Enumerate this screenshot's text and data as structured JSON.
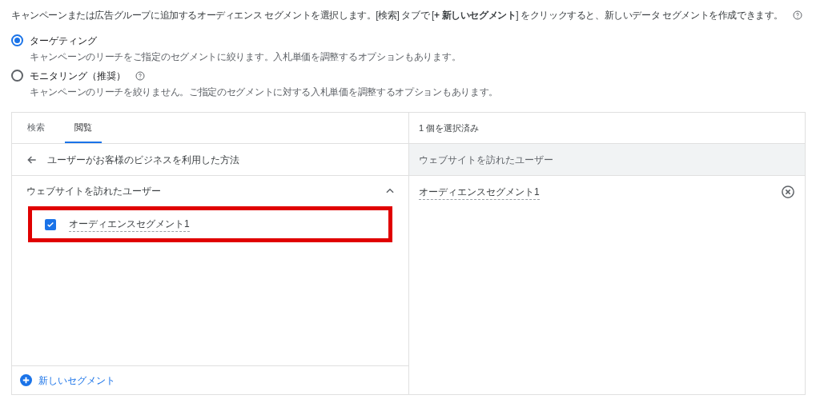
{
  "intro": "キャンペーンまたは広告グループに追加するオーディエンス セグメントを選択します。[検索] タブで [**+ 新しいセグメント**] をクリックすると、新しいデータ セグメントを作成できます。",
  "options": [
    {
      "label": "ターゲティング",
      "description": "キャンペーンのリーチをご指定のセグメントに絞ります。入札単価を調整するオプションもあります。",
      "selected": true,
      "help": false
    },
    {
      "label": "モニタリング（推奨）",
      "description": "キャンペーンのリーチを絞りません。ご指定のセグメントに対する入札単価を調整するオプションもあります。",
      "selected": false,
      "help": true
    }
  ],
  "tabs": [
    {
      "label": "検索",
      "selected": false
    },
    {
      "label": "閲覧",
      "selected": true
    }
  ],
  "breadcrumb": "ユーザーがお客様のビジネスを利用した方法",
  "group": {
    "title": "ウェブサイトを訪れたユーザー",
    "expanded": true,
    "items": [
      {
        "label": "オーディエンスセグメント1",
        "checked": true,
        "highlighted": true
      }
    ]
  },
  "new_segment": "新しいセグメント",
  "selected_panel": {
    "count": "1 個を選択済み",
    "group": "ウェブサイトを訪れたユーザー",
    "items": [
      "オーディエンスセグメント1"
    ]
  }
}
